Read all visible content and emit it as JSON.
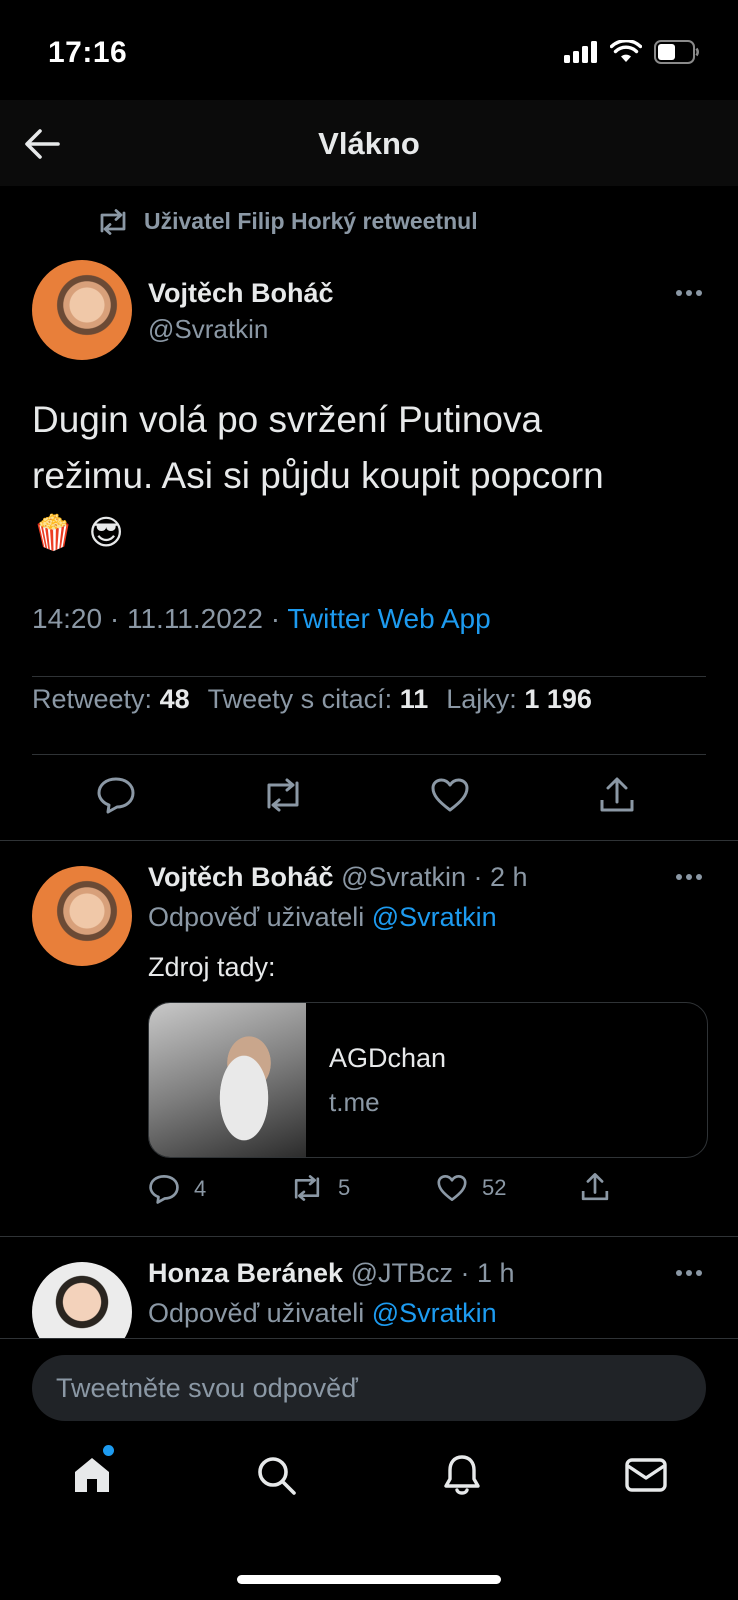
{
  "status": {
    "time": "17:16"
  },
  "header": {
    "title": "Vlákno"
  },
  "main_tweet": {
    "retweeted_by": "Uživatel Filip Horký retweetnul",
    "author_name": "Vojtěch Boháč",
    "author_handle": "@Svratkin",
    "text_line1": "Dugin volá po svržení Putinova",
    "text_line2": "režimu. Asi si půjdu koupit popcorn",
    "emoji1": "🍿",
    "emoji2": "😎",
    "time": "14:20",
    "date": "11.11.2022",
    "separator": "·",
    "source": "Twitter Web App",
    "stats": {
      "retweets_label": "Retweety:",
      "retweets": "48",
      "quotes_label": "Tweety s citací:",
      "quotes": "11",
      "likes_label": "Lajky:",
      "likes": "1 196"
    }
  },
  "replies": [
    {
      "author_name": "Vojtěch Boháč",
      "author_handle": "@Svratkin",
      "time": "· 2 h",
      "reply_to_label": "Odpověď uživateli",
      "reply_to_handle": "@Svratkin",
      "text": "Zdroj tady:",
      "card": {
        "title": "AGDchan",
        "domain": "t.me"
      },
      "counts": {
        "replies": "4",
        "retweets": "5",
        "likes": "52"
      }
    },
    {
      "author_name": "Honza Beránek",
      "author_handle": "@JTBcz",
      "time": "· 1 h",
      "reply_to_label": "Odpověď uživateli",
      "reply_to_handle": "@Svratkin"
    }
  ],
  "composer": {
    "placeholder": "Tweetněte svou odpověď"
  },
  "colors": {
    "accent": "#1d9bf0",
    "background": "#000000",
    "muted": "#8b98a5",
    "text": "#e7e9ea"
  },
  "icons": [
    "back-arrow-icon",
    "retweet-icon",
    "more-icon",
    "reply-icon",
    "like-icon",
    "share-icon",
    "home-icon",
    "search-icon",
    "bell-icon",
    "mail-icon"
  ]
}
